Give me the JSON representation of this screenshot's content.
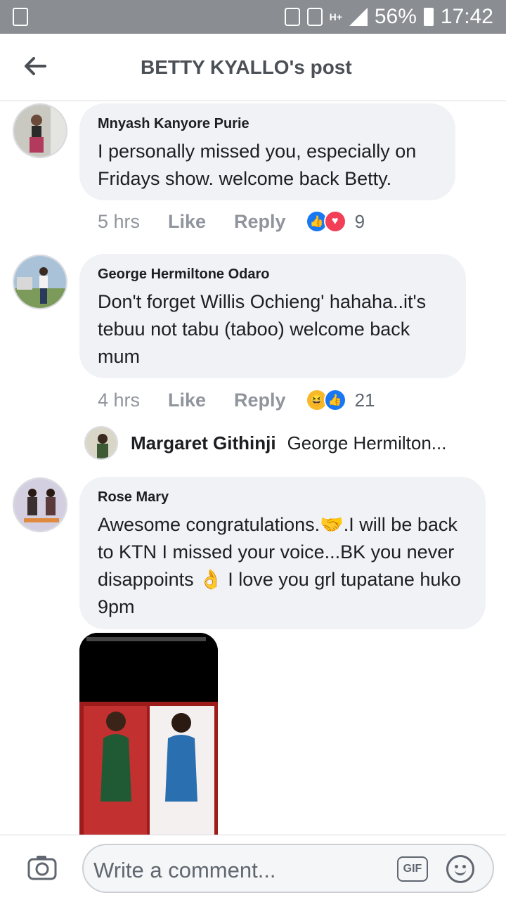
{
  "status": {
    "battery": "56%",
    "time": "17:42",
    "network": "H+"
  },
  "header": {
    "title": "BETTY KYALLO's post"
  },
  "comments": [
    {
      "author": "Mnyash Kanyore Purie",
      "text": "I personally missed you, especially on Fridays show. welcome back Betty.",
      "time": "5 hrs",
      "like": "Like",
      "reply": "Reply",
      "reactions": "9"
    },
    {
      "author": "George Hermiltone Odaro",
      "text": "Don't forget Willis Ochieng' hahaha..it's tebuu not tabu (taboo) welcome back mum",
      "time": "4 hrs",
      "like": "Like",
      "reply": "Reply",
      "reactions": "21",
      "reply_preview": {
        "author": "Margaret Githinji",
        "text": "George Hermilton..."
      }
    },
    {
      "author": "Rose Mary",
      "text": "Awesome congratulations.🤝.I will be back to KTN I missed your voice...BK you never disappoints 👌 I love you grl tupatane huko 9pm"
    }
  ],
  "composer": {
    "placeholder": "Write a comment...",
    "gif": "GIF"
  }
}
